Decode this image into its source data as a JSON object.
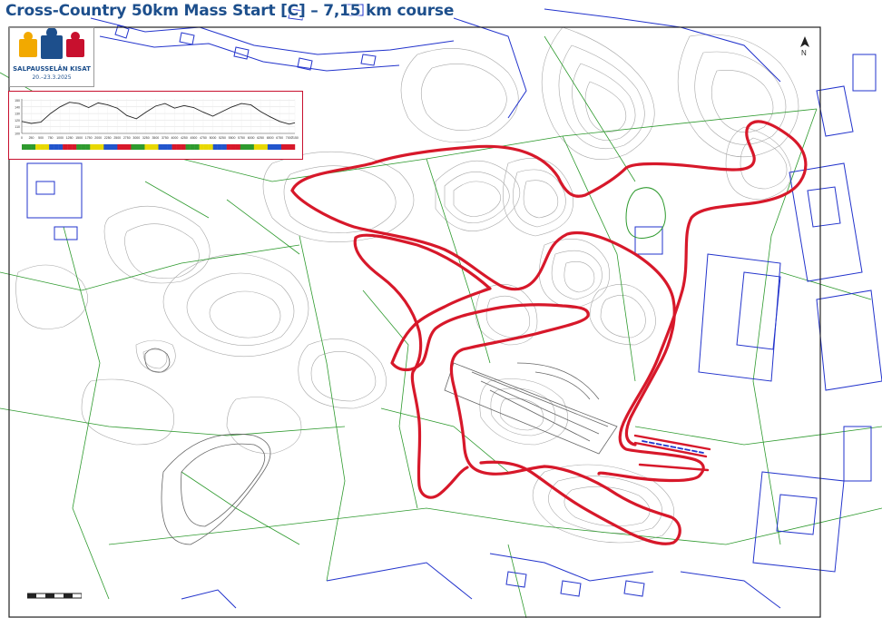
{
  "header": {
    "title": "Cross-Country 50km Mass Start [C] – 7,15 km course"
  },
  "logo": {
    "brand": "SALPAUSSELÄN KISAT",
    "dates": "20.–23.3.2025",
    "figure_colors": [
      "#f2a900",
      "#1d4f8c",
      "#c8102e"
    ]
  },
  "map": {
    "north_label": "N",
    "colors": {
      "course": "#d7182a",
      "buildings": "#2233cc",
      "paths": "#2e9a2e",
      "contours": "#8a8a8a",
      "frame": "#222222"
    }
  },
  "profile": {
    "x_ticks": [
      "0",
      "250",
      "500",
      "750",
      "1000",
      "1250",
      "1500",
      "1750",
      "2000",
      "2250",
      "2500",
      "2750",
      "3000",
      "3250",
      "3500",
      "3750",
      "4000",
      "4250",
      "4500",
      "4750",
      "5000",
      "5250",
      "5500",
      "5750",
      "6000",
      "6250",
      "6500",
      "6750",
      "7000",
      "7150"
    ],
    "y_ticks": [
      "150",
      "140",
      "130",
      "120",
      "110",
      "100"
    ],
    "segment_colors": [
      "#2e9a2e",
      "#e8d800",
      "#2255cc",
      "#d7182a"
    ]
  },
  "chart_data": {
    "type": "line",
    "title": "",
    "xlabel": "",
    "ylabel": "",
    "xlim": [
      0,
      7150
    ],
    "ylim": [
      100,
      152
    ],
    "series": [
      {
        "x": [
          0,
          250,
          500,
          750,
          1000,
          1250,
          1500,
          1750,
          2000,
          2250,
          2500,
          2750,
          3000,
          3250,
          3500,
          3750,
          4000,
          4250,
          4500,
          4750,
          5000,
          5250,
          5500,
          5750,
          6000,
          6250,
          6500,
          6750,
          7000,
          7150
        ],
        "values": [
          118,
          115,
          117,
          130,
          140,
          147,
          145,
          139,
          146,
          143,
          138,
          127,
          122,
          132,
          141,
          145,
          138,
          142,
          139,
          132,
          126,
          133,
          140,
          145,
          143,
          133,
          125,
          118,
          114,
          116
        ]
      }
    ],
    "grid": true
  }
}
